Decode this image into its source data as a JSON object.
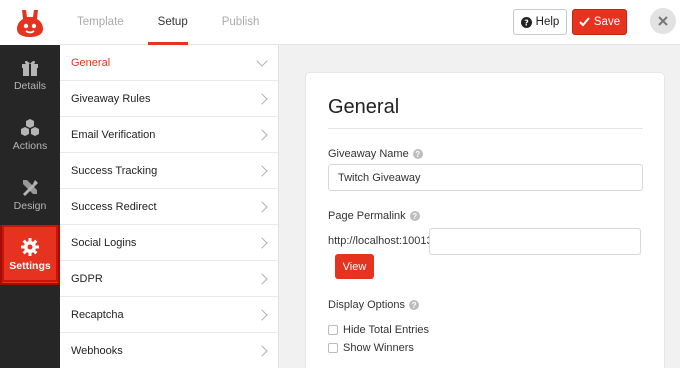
{
  "topbar": {
    "tabs": [
      {
        "label": "Template",
        "active": false
      },
      {
        "label": "Setup",
        "active": true
      },
      {
        "label": "Publish",
        "active": false
      }
    ],
    "help_label": "Help",
    "save_label": "Save"
  },
  "rail": {
    "items": [
      {
        "label": "Details",
        "icon": "gift-icon",
        "active": false
      },
      {
        "label": "Actions",
        "icon": "cubes-icon",
        "active": false
      },
      {
        "label": "Design",
        "icon": "design-tools-icon",
        "active": false
      },
      {
        "label": "Settings",
        "icon": "gear-icon",
        "active": true
      }
    ]
  },
  "settings_nav": {
    "items": [
      {
        "label": "General",
        "active": true
      },
      {
        "label": "Giveaway Rules",
        "active": false
      },
      {
        "label": "Email Verification",
        "active": false
      },
      {
        "label": "Success Tracking",
        "active": false
      },
      {
        "label": "Success Redirect",
        "active": false
      },
      {
        "label": "Social Logins",
        "active": false
      },
      {
        "label": "GDPR",
        "active": false
      },
      {
        "label": "Recaptcha",
        "active": false
      },
      {
        "label": "Webhooks",
        "active": false
      }
    ]
  },
  "panel": {
    "title": "General",
    "giveaway_name_label": "Giveaway Name",
    "giveaway_name_value": "Twitch Giveaway",
    "permalink_label": "Page Permalink",
    "permalink_prefix": "http://localhost:10013/",
    "permalink_value": "",
    "view_label": "View",
    "display_options_label": "Display Options",
    "options": [
      {
        "label": "Hide Total Entries",
        "checked": false
      },
      {
        "label": "Show Winners",
        "checked": false
      }
    ]
  },
  "colors": {
    "accent": "#e6331f",
    "rail_bg": "#262626",
    "page_bg": "#f1f1f1"
  }
}
